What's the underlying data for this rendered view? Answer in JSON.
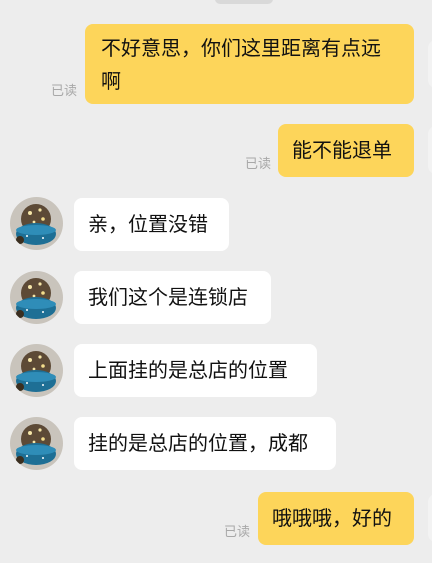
{
  "messages": [
    {
      "id": "m1",
      "side": "out",
      "text": "不好意思，你们这里距离有点远\n啊",
      "read_label": "已读"
    },
    {
      "id": "m2",
      "side": "out",
      "text": "能不能退单",
      "read_label": "已读"
    },
    {
      "id": "m3",
      "side": "in",
      "text": "亲，位置没错"
    },
    {
      "id": "m4",
      "side": "in",
      "text": "我们这个是连锁店"
    },
    {
      "id": "m5",
      "side": "in",
      "text": "上面挂的是总店的位置"
    },
    {
      "id": "m6",
      "side": "in",
      "text": "挂的是总店的位置，成都"
    },
    {
      "id": "m7",
      "side": "out",
      "text": "哦哦哦，好的",
      "read_label": "已读"
    }
  ],
  "colors": {
    "background": "#ededed",
    "outgoing_bubble": "#fdd55a",
    "incoming_bubble": "#ffffff",
    "read_label": "#a8a8a8"
  },
  "icons": {
    "contact_avatar": "snow-globe-avatar-icon"
  }
}
